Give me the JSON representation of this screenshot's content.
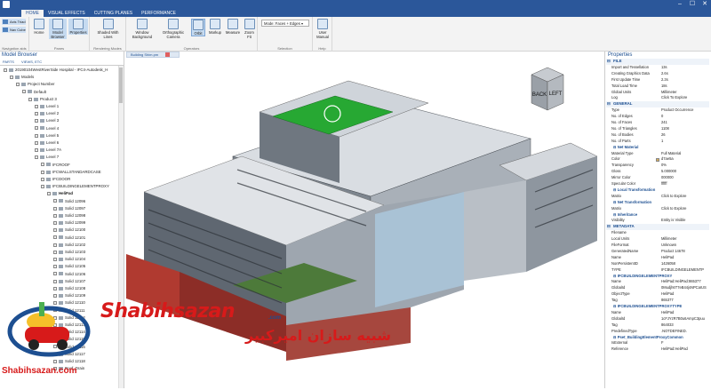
{
  "titlebar": {
    "title": ""
  },
  "tabs": [
    "HOME",
    "VISUAL EFFECTS",
    "CUTTING PLANES",
    "PERFORMANCE"
  ],
  "ribbon": {
    "navigation": {
      "axis_triad": "Axis Triad",
      "nav_cube": "Nav Cube",
      "label": "Navigation aids"
    },
    "panes": {
      "home": "Home",
      "model_browser": "Model Browser",
      "properties": "Properties",
      "label": "Panes"
    },
    "rendering": {
      "shaded": "Shaded With Lines",
      "label": "Rendering Modes"
    },
    "operators": {
      "window_bg": "Window Background",
      "ortho": "Orthographic Camera",
      "orbit": "Orbit",
      "markup": "Markup",
      "measure": "Measure",
      "zoom_fit": "Zoom Fit",
      "label": "Operators"
    },
    "selection": {
      "mode": "Mode: Faces + Edges",
      "label": "Selection"
    },
    "help": {
      "manual": "User Manual",
      "label": "Help"
    }
  },
  "model_browser": {
    "title": "Model Browser",
    "tabs": [
      "PARTS",
      "VIEWS, ETC"
    ],
    "tree": [
      {
        "t": "20190104WestRiverSide Hospital - IFC4-Autodesk_H",
        "d": 0
      },
      {
        "t": "Models",
        "d": 1
      },
      {
        "t": "Project Number",
        "d": 2
      },
      {
        "t": "Default",
        "d": 3
      },
      {
        "t": "Product 3",
        "d": 4
      },
      {
        "t": "Level 1",
        "d": 5
      },
      {
        "t": "Level 2",
        "d": 5
      },
      {
        "t": "Level 3",
        "d": 5
      },
      {
        "t": "Level 4",
        "d": 5
      },
      {
        "t": "Level 5",
        "d": 5
      },
      {
        "t": "Level 6",
        "d": 5
      },
      {
        "t": "Level 7A",
        "d": 5
      },
      {
        "t": "Level 7",
        "d": 5
      },
      {
        "t": "IFCROOF",
        "d": 6
      },
      {
        "t": "IFCWALLSTANDARDCASE",
        "d": 6
      },
      {
        "t": "IFCDOOR",
        "d": 6
      },
      {
        "t": "IFCBUILDINGELEMENTPROXY",
        "d": 6
      },
      {
        "t": "HeliPad",
        "d": 7
      },
      {
        "t": "Solid 12096",
        "d": 8
      },
      {
        "t": "Solid 12097",
        "d": 8
      },
      {
        "t": "Solid 12098",
        "d": 8
      },
      {
        "t": "Solid 12099",
        "d": 8
      },
      {
        "t": "Solid 12100",
        "d": 8
      },
      {
        "t": "Solid 12101",
        "d": 8
      },
      {
        "t": "Solid 12102",
        "d": 8
      },
      {
        "t": "Solid 12103",
        "d": 8
      },
      {
        "t": "Solid 12104",
        "d": 8
      },
      {
        "t": "Solid 12105",
        "d": 8
      },
      {
        "t": "Solid 12106",
        "d": 8
      },
      {
        "t": "Solid 12107",
        "d": 8
      },
      {
        "t": "Solid 12108",
        "d": 8
      },
      {
        "t": "Solid 12109",
        "d": 8
      },
      {
        "t": "Solid 12110",
        "d": 8
      },
      {
        "t": "Solid 12111",
        "d": 8
      },
      {
        "t": "Solid 12112",
        "d": 8
      },
      {
        "t": "Solid 12113",
        "d": 8
      },
      {
        "t": "Solid 12114",
        "d": 8
      },
      {
        "t": "Solid 12115",
        "d": 8
      },
      {
        "t": "Solid 12116",
        "d": 8
      },
      {
        "t": "Solid 12117",
        "d": 8
      },
      {
        "t": "Solid 12118",
        "d": 8
      },
      {
        "t": "Roof_Drain",
        "d": 8
      }
    ]
  },
  "viewport": {
    "tab": "Building Shim.pm",
    "navcube_back": "BACK",
    "navcube_left": "LEFT"
  },
  "properties": {
    "title": "Properties",
    "rows": [
      {
        "s": "FILE"
      },
      {
        "k": "Import and Tessellation",
        "v": "13s"
      },
      {
        "k": "Creating Graphics Data",
        "v": "2.6s"
      },
      {
        "k": "First Update Time",
        "v": "2.3s"
      },
      {
        "k": "Total Load Time",
        "v": "18s"
      },
      {
        "k": "Global Units",
        "v": "Millimeter"
      },
      {
        "k": "Log",
        "v": "Click To Explore"
      },
      {
        "s": "GENERAL"
      },
      {
        "k": "Type",
        "v": "Product Occurrence"
      },
      {
        "k": "No. of Edges",
        "v": "0"
      },
      {
        "k": "No. of Faces",
        "v": "241"
      },
      {
        "k": "No. of Triangles",
        "v": "1108"
      },
      {
        "k": "No. of Bodies",
        "v": "26"
      },
      {
        "k": "No. of Parts",
        "v": "1"
      },
      {
        "sub": "Net Material"
      },
      {
        "k": "Material Type",
        "v": "Full Material"
      },
      {
        "k": "Color",
        "v": "d7ae5a"
      },
      {
        "k": "Transparency",
        "v": "0%"
      },
      {
        "k": "Gloss",
        "v": "5.000000"
      },
      {
        "k": "Mirror Color",
        "v": "000000"
      },
      {
        "k": "Specular Color",
        "v": "ffffff"
      },
      {
        "sub": "Local Transformation"
      },
      {
        "k": "Matrix",
        "v": "Click to Explore"
      },
      {
        "sub": "Net Transformation"
      },
      {
        "k": "Matrix",
        "v": "Click to Explore"
      },
      {
        "sub": "Inheritance"
      },
      {
        "k": "Visibility",
        "v": "Entity is Visible"
      },
      {
        "s": "METADATA"
      },
      {
        "k": "Filename",
        "v": ""
      },
      {
        "k": "Local Units",
        "v": "Millimeter"
      },
      {
        "k": "FileFormat",
        "v": "Unknown"
      },
      {
        "k": "GeneratedName",
        "v": "Product 14678"
      },
      {
        "k": "Name",
        "v": "HeliPad"
      },
      {
        "k": "NonPersistentID",
        "v": "1426058"
      },
      {
        "k": "TYPE",
        "v": "IFCBUILDINGELEMENTP"
      },
      {
        "sub": "IFCBUILDINGELEMENTPROXY"
      },
      {
        "k": "Name",
        "v": "HeliPad:HeliPad:865377"
      },
      {
        "k": "GlobalId",
        "v": "0Mudjh6T7eB44jsNPCaIUS"
      },
      {
        "k": "ObjectType",
        "v": "HeliPad"
      },
      {
        "k": "Tag",
        "v": "865377"
      },
      {
        "sub": "IFCBUILDINGELEMENTPROXYTYPE"
      },
      {
        "k": "Name",
        "v": "HeliPad"
      },
      {
        "k": "GlobalId",
        "v": "1cFJYzR7B0u6AmpC3puu"
      },
      {
        "k": "Tag",
        "v": "864033"
      },
      {
        "k": "PredefinedType",
        "v": ".NOTDEFINED."
      },
      {
        "sub": "Pset_BuildingElementProxyCommon"
      },
      {
        "k": "IsExternal",
        "v": "F"
      },
      {
        "k": "Reference",
        "v": "HeliPad:HeliPad"
      }
    ]
  },
  "watermark": {
    "brand_latin": "Shabihsazan",
    "brand_suffix": ".com",
    "brand_farsi": "شبیه سازان امیرکبیر",
    "site": "Shabihsazan.com"
  },
  "colors": {
    "accent": "#2b579a",
    "helipad": "#27a833",
    "brick": "#b03a30",
    "brand_red": "#d71a1a"
  }
}
